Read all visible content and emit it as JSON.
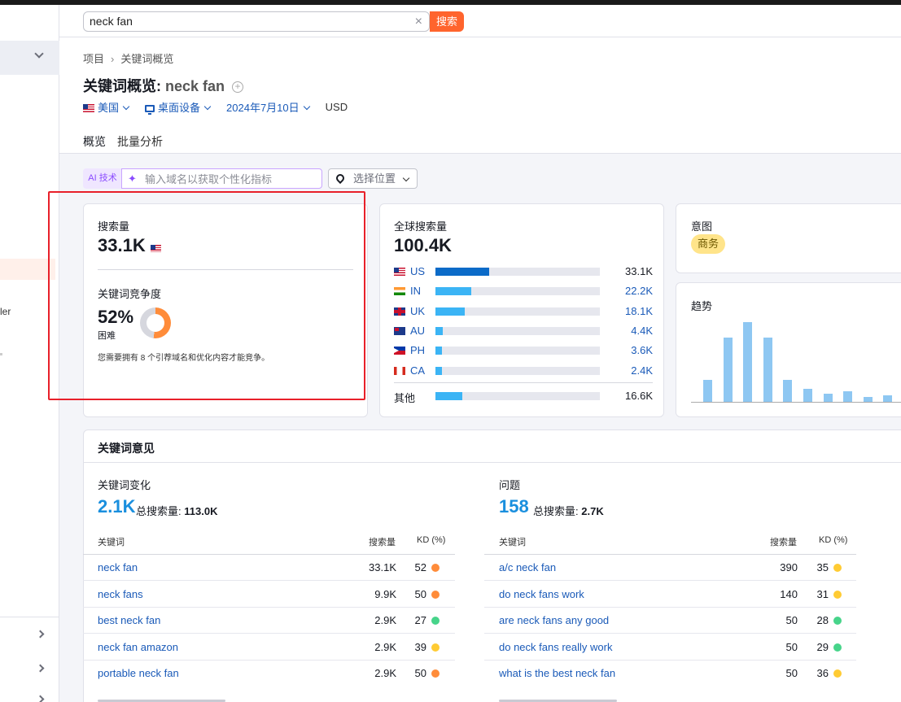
{
  "search": {
    "value": "neck fan",
    "clear": "×",
    "button": "搜索"
  },
  "sidebar": {
    "partial_text": "ler"
  },
  "breadcrumb": {
    "root": "项目",
    "sep": "›",
    "current": "关键词概览"
  },
  "title": {
    "prefix": "关键词概览:",
    "keyword": "neck fan",
    "plus": "+"
  },
  "filters": {
    "country": "美国",
    "device": "桌面设备",
    "date": "2024年7月10日",
    "currency": "USD"
  },
  "tabs": [
    {
      "label": "概览",
      "active": true
    },
    {
      "label": "批量分析",
      "active": false
    }
  ],
  "ai": {
    "badge": "AI 技术",
    "sparkle": "✦",
    "placeholder": "输入域名以获取个性化指标",
    "location": "选择位置"
  },
  "volume_card": {
    "label": "搜索量",
    "value": "33.1K",
    "kd_label": "关键词竞争度",
    "kd_value": "52%",
    "kd_level": "困难",
    "kd_percent": 52,
    "kd_note": "您需要拥有 8 个引荐域名和优化内容才能竞争。"
  },
  "global_card": {
    "label": "全球搜索量",
    "value": "100.4K",
    "rows": [
      {
        "code": "US",
        "value": "33.1K",
        "share": 0.33,
        "flag": "flag-usr",
        "color": "#0b6bc8"
      },
      {
        "code": "IN",
        "value": "22.2K",
        "share": 0.22,
        "flag": "flag-in",
        "color": "#3bb4f5"
      },
      {
        "code": "UK",
        "value": "18.1K",
        "share": 0.18,
        "flag": "flag-uk",
        "color": "#3bb4f5"
      },
      {
        "code": "AU",
        "value": "4.4K",
        "share": 0.044,
        "flag": "flag-au",
        "color": "#3bb4f5"
      },
      {
        "code": "PH",
        "value": "3.6K",
        "share": 0.036,
        "flag": "flag-ph",
        "color": "#3bb4f5"
      },
      {
        "code": "CA",
        "value": "2.4K",
        "share": 0.024,
        "flag": "flag-ca",
        "color": "#3bb4f5"
      }
    ],
    "other_label": "其他",
    "other_value": "16.6K",
    "other_share": 0.166
  },
  "intent_card": {
    "label": "意图",
    "badge": "商务"
  },
  "trend_card": {
    "label": "趋势",
    "bars": [
      0.28,
      0.81,
      1.0,
      0.81,
      0.28,
      0.16,
      0.1,
      0.13,
      0.06,
      0.08
    ]
  },
  "ideas": {
    "title": "关键词意见",
    "variations": {
      "label": "关键词变化",
      "count": "2.1K",
      "total_label": "总搜索量:",
      "total": "113.0K",
      "headers": {
        "keyword": "关键词",
        "volume": "搜索量",
        "kd": "KD (%)"
      },
      "rows": [
        {
          "keyword": "neck fan",
          "volume": "33.1K",
          "kd": "52",
          "color": "orange"
        },
        {
          "keyword": "neck fans",
          "volume": "9.9K",
          "kd": "50",
          "color": "orange"
        },
        {
          "keyword": "best neck fan",
          "volume": "2.9K",
          "kd": "27",
          "color": "green"
        },
        {
          "keyword": "neck fan amazon",
          "volume": "2.9K",
          "kd": "39",
          "color": "yellow"
        },
        {
          "keyword": "portable neck fan",
          "volume": "2.9K",
          "kd": "50",
          "color": "orange"
        }
      ]
    },
    "questions": {
      "label": "问题",
      "count": "158",
      "total_label": "总搜索量:",
      "total": "2.7K",
      "headers": {
        "keyword": "关键词",
        "volume": "搜索量",
        "kd": "KD (%)"
      },
      "rows": [
        {
          "keyword": "a/c neck fan",
          "volume": "390",
          "kd": "35",
          "color": "yellow"
        },
        {
          "keyword": "do neck fans work",
          "volume": "140",
          "kd": "31",
          "color": "yellow"
        },
        {
          "keyword": "are neck fans any good",
          "volume": "50",
          "kd": "28",
          "color": "green"
        },
        {
          "keyword": "do neck fans really work",
          "volume": "50",
          "kd": "29",
          "color": "green"
        },
        {
          "keyword": "what is the best neck fan",
          "volume": "50",
          "kd": "36",
          "color": "yellow"
        }
      ]
    }
  }
}
